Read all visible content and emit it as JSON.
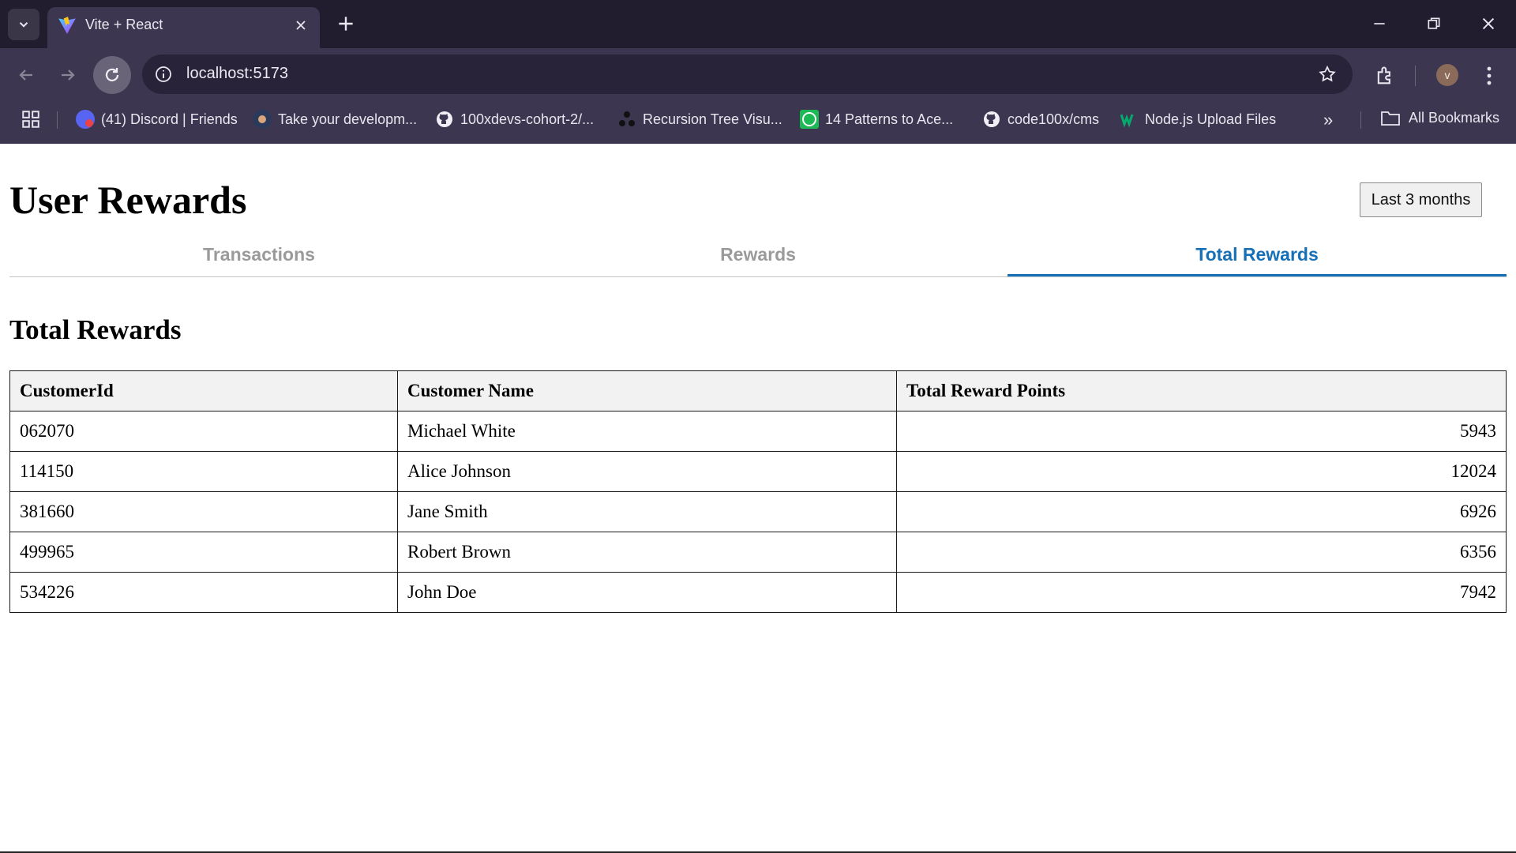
{
  "browser": {
    "tab_title": "Vite + React",
    "url": "localhost:5173",
    "avatar_letter": "v",
    "bookmarks": [
      {
        "label": "(41) Discord | Friends",
        "icon": "discord-icon"
      },
      {
        "label": "Take your developm...",
        "icon": "profile-icon"
      },
      {
        "label": "100xdevs-cohort-2/...",
        "icon": "github-icon"
      },
      {
        "label": "Recursion Tree Visu...",
        "icon": "tree-icon"
      },
      {
        "label": "14 Patterns to Ace...",
        "icon": "clock-icon"
      },
      {
        "label": "code100x/cms",
        "icon": "github-icon"
      },
      {
        "label": "Node.js Upload Files",
        "icon": "w3schools-icon"
      }
    ],
    "more_bookmarks": "»",
    "all_bookmarks": "All Bookmarks"
  },
  "page": {
    "title": "User Rewards",
    "range_button": "Last 3 months",
    "tabs": [
      {
        "label": "Transactions",
        "active": false
      },
      {
        "label": "Rewards",
        "active": false
      },
      {
        "label": "Total Rewards",
        "active": true
      }
    ],
    "section_title": "Total Rewards",
    "table": {
      "headers": [
        "CustomerId",
        "Customer Name",
        "Total Reward Points"
      ],
      "rows": [
        [
          "062070",
          "Michael White",
          "5943"
        ],
        [
          "114150",
          "Alice Johnson",
          "12024"
        ],
        [
          "381660",
          "Jane Smith",
          "6926"
        ],
        [
          "499965",
          "Robert Brown",
          "6356"
        ],
        [
          "534226",
          "John Doe",
          "7942"
        ]
      ]
    }
  },
  "colors": {
    "accent": "#1670b8",
    "chrome_dark": "#211c2e",
    "chrome_toolbar": "#3d3650"
  }
}
